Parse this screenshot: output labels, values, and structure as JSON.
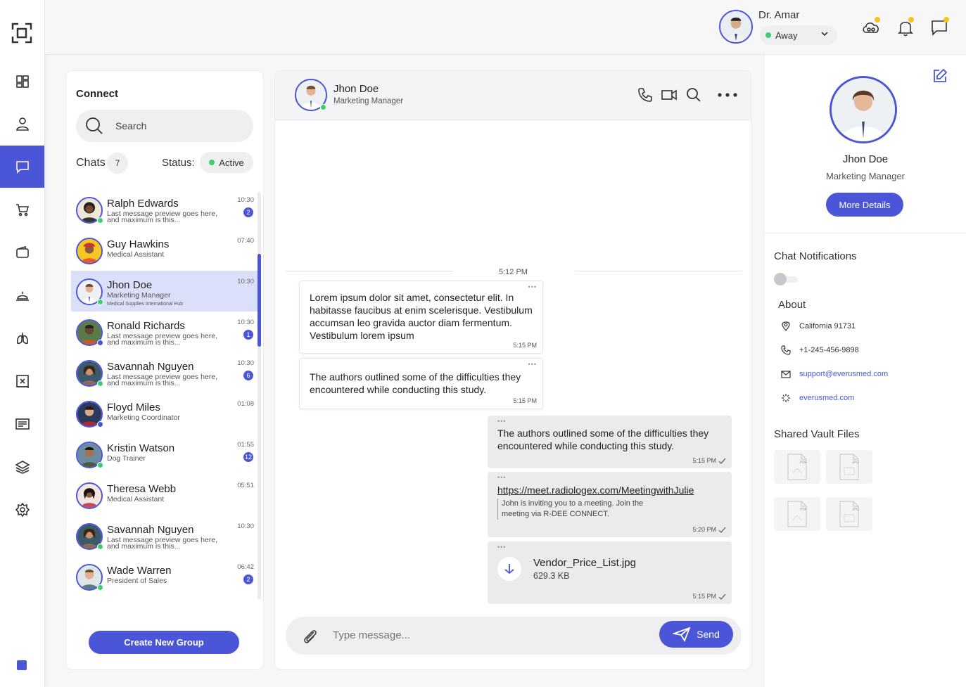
{
  "user": {
    "name": "Dr. Amar",
    "status": "Away"
  },
  "sidebar": {
    "items": [
      {
        "icon": "dashboard-icon"
      },
      {
        "icon": "user-icon"
      },
      {
        "icon": "chat-icon",
        "active": true
      },
      {
        "icon": "cart-icon"
      },
      {
        "icon": "wallet-icon"
      },
      {
        "icon": "service-bell-icon"
      },
      {
        "icon": "lungs-icon"
      },
      {
        "icon": "xray-icon"
      },
      {
        "icon": "list-icon"
      },
      {
        "icon": "layers-icon"
      },
      {
        "icon": "settings-icon"
      }
    ]
  },
  "connect": {
    "title": "Connect",
    "search_placeholder": "Search",
    "chats_label": "Chats",
    "chats_count": "7",
    "status_label": "Status:",
    "status_value": "Active",
    "create_group": "Create New Group"
  },
  "chats": [
    {
      "name": "Ralph Edwards",
      "sub": "Last message preview goes here, and maximum is this...",
      "time": "10:30",
      "badge": "2",
      "online": true
    },
    {
      "name": "Guy Hawkins",
      "sub": "Medical Assistant",
      "time": "07:40",
      "badge": "",
      "online": false
    },
    {
      "name": "Jhon Doe",
      "sub": "Marketing Manager",
      "sub2": "Medical Supplies International Hub",
      "time": "10:30",
      "badge": "",
      "online": true,
      "active": true
    },
    {
      "name": "Ronald Richards",
      "sub": "Last message preview goes here, and maximum is this...",
      "time": "10:30",
      "badge": "1",
      "online": false
    },
    {
      "name": "Savannah Nguyen",
      "sub": "Last message preview goes here, and maximum is this...",
      "time": "10:30",
      "badge": "6",
      "online": true
    },
    {
      "name": "Floyd Miles",
      "sub": "Marketing Coordinator",
      "time": "01:08",
      "badge": "",
      "online": false
    },
    {
      "name": "Kristin Watson",
      "sub": "Dog Trainer",
      "time": "01:55",
      "badge": "12",
      "online": true
    },
    {
      "name": "Theresa Webb",
      "sub": "Medical Assistant",
      "time": "05:51",
      "badge": "",
      "online": false
    },
    {
      "name": "Savannah Nguyen",
      "sub": "Last message preview goes here, and maximum is this...",
      "time": "10:30",
      "badge": "",
      "online": true
    },
    {
      "name": "Wade Warren",
      "sub": "President of Sales",
      "time": "06:42",
      "badge": "2",
      "online": true
    }
  ],
  "conversation": {
    "name": "Jhon Doe",
    "role": "Marketing Manager",
    "divider_time": "5:12 PM",
    "messages": {
      "m1_text": "Lorem ipsum dolor sit amet, consectetur elit. In habitasse faucibus at enim scelerisque. Vestibulum accumsan leo gravida auctor diam fermentum. Vestibulum lorem ipsum",
      "m1_time": "5:15 PM",
      "m2_text": "The authors outlined some of the difficulties they encountered while conducting this study.",
      "m2_time": "5:15 PM",
      "m3_text": "The authors outlined some of the difficulties they encountered while conducting this study.",
      "m3_time": "5:15 PM",
      "m4_link": "https://meet.radiologex.com/MeetingwithJulie",
      "m4_quote": "John is inviting you to a meeting. Join the meeting via R-DEE CONNECT.",
      "m4_time": "5:20 PM",
      "m5_file": "Vendor_Price_List.jpg",
      "m5_size": "629.3 KB",
      "m5_time": "5:15 PM"
    },
    "composer_placeholder": "Type message...",
    "send_label": "Send"
  },
  "profile": {
    "name": "Jhon Doe",
    "role": "Marketing Manager",
    "more_details": "More Details",
    "notifications_title": "Chat Notifications",
    "about_title": "About",
    "location": "California  91731",
    "phone": "+1-245-456-9898",
    "email": "support@everusmed.com",
    "website": "everusmed.com",
    "vault_title": "Shared Vault Files",
    "vault_files": [
      {
        "type": "PDF"
      },
      {
        "type": "JPG"
      },
      {
        "type": "PDF"
      },
      {
        "type": "JPG"
      }
    ]
  },
  "colors": {
    "accent": "#4a55d8",
    "online": "#3fce6b",
    "notify": "#f5c518"
  }
}
